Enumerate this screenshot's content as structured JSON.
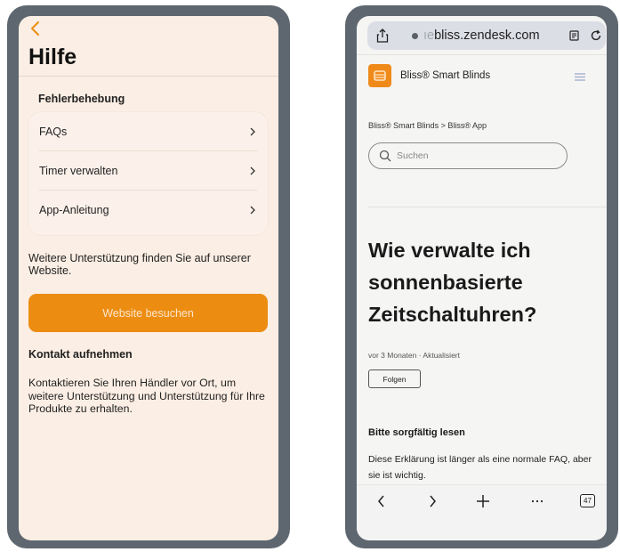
{
  "left_app": {
    "title": "Hilfe",
    "section_label": "Fehlerbehebung",
    "menu_items": [
      {
        "label": "FAQs"
      },
      {
        "label": "Timer verwalten"
      },
      {
        "label": "App-Anleitung"
      }
    ],
    "support_text": "Weitere Unterstützung finden Sie auf unserer Website.",
    "website_button": "Website besuchen",
    "contact_title": "Kontakt aufnehmen",
    "contact_text": "Kontaktieren Sie Ihren Händler vor Ort, um weitere Unterstützung und Unterstützung für Ihre Produkte zu erhalten.",
    "colors": {
      "accent": "#ec8d12",
      "background": "#fbeee4"
    }
  },
  "right_browser": {
    "url_faded": "‹bliss.",
    "url_main": "bliss.zendesk.com",
    "site_brand": "Bliss® Smart Blinds",
    "breadcrumb": "Bliss® Smart Blinds  >  Bliss® App",
    "search_placeholder": "Suchen",
    "article_title": "Wie verwalte ich sonnenbasierte Zeitschaltuhren?",
    "meta": "vor 3 Monaten · Aktualisiert",
    "follow_button": "Folgen",
    "section_heading": "Bitte sorgfältig lesen",
    "body_text": "Diese Erklärung ist länger als eine normale FAQ, aber sie ist wichtig.",
    "tab_count": "47",
    "icons": [
      "share-icon",
      "reader-icon",
      "reload-icon",
      "menu-icon",
      "search-icon",
      "back-icon",
      "forward-icon",
      "plus-icon",
      "more-icon",
      "tabs-icon"
    ],
    "colors": {
      "logo": "#ef8a1a",
      "background": "#f5f5f4"
    }
  }
}
